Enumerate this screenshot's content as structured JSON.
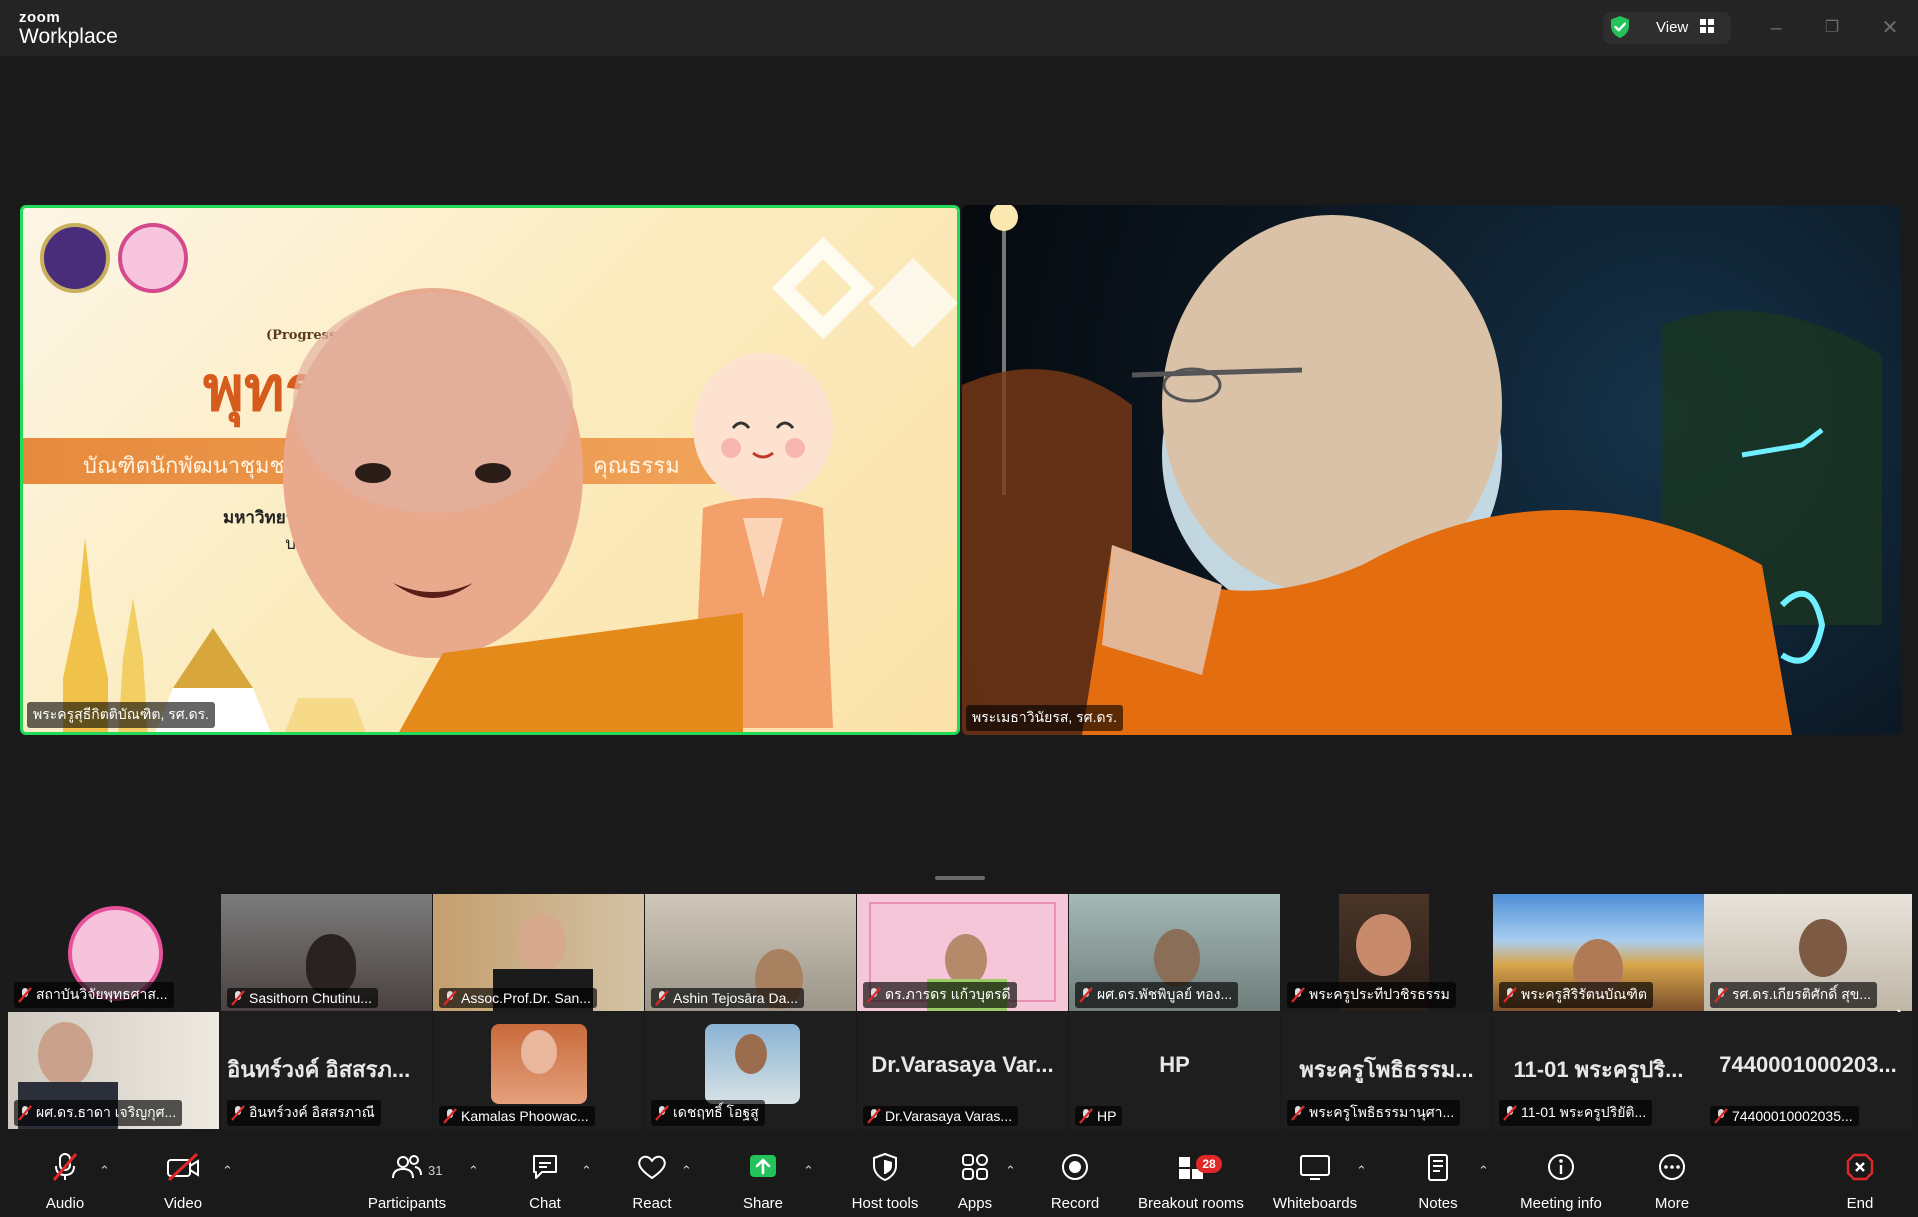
{
  "app": {
    "brand_top": "zoom",
    "brand_bottom": "Workplace",
    "view_label": "View"
  },
  "colors": {
    "active_speaker": "#23d959",
    "end_red": "#e02828",
    "share_green": "#23c25a"
  },
  "main_tiles": [
    {
      "name": "พระครูสุธีกิตติบัณฑิต, รศ.ดร."
    },
    {
      "name": "พระเมธาวินัยรส, รศ.ดร."
    }
  ],
  "slide": {
    "small_title": "(Progress Rep",
    "big_title": "พุทร",
    "banner_left": "บัณฑิตนักพัฒนาชุมชนเชิ",
    "banner_right": "คุณธรรม",
    "sub1": "มหาวิทยาลัย",
    "sub2": "ประ"
  },
  "thumbnails_row1": [
    {
      "label": "สถาบันวิจัยพุทธศาส..."
    },
    {
      "label": "Sasithorn Chutinu..."
    },
    {
      "label": "Assoc.Prof.Dr. San..."
    },
    {
      "label": "Ashin Tejosāra Da..."
    },
    {
      "label": "ดร.ภารดร แก้วบุตรดี"
    },
    {
      "label": "ผศ.ดร.พัชพิบูลย์ ทอง..."
    },
    {
      "label": "พระครูประทีปวชิรธรรม"
    },
    {
      "label": "พระครูสิริรัตนบัณฑิต"
    },
    {
      "label": "รศ.ดร.เกียรติศักดิ์ สุข..."
    }
  ],
  "thumbnails_row2": [
    {
      "label": "ผศ.ดร.ธาดา เจริญกุศ...",
      "display": ""
    },
    {
      "label": "อินทร์วงค์ อิสสรภาณี",
      "display": "อินทร์วงค์ อิสสรภ..."
    },
    {
      "label": "Kamalas Phoowac...",
      "display": ""
    },
    {
      "label": "เดชฤทธิ์ โอฐสู",
      "display": ""
    },
    {
      "label": "Dr.Varasaya Varas...",
      "display": "Dr.Varasaya Var..."
    },
    {
      "label": "HP",
      "display": "HP"
    },
    {
      "label": "พระครูโพธิธรรมานุศา...",
      "display": "พระครูโพธิธรรม..."
    },
    {
      "label": "11-01 พระครูปริยัติ...",
      "display": "11-01 พระครูปริ..."
    },
    {
      "label": "74400010002035...",
      "display": "7440001000203..."
    }
  ],
  "toolbar": {
    "audio": "Audio",
    "video": "Video",
    "participants": "Participants",
    "participants_count": "31",
    "chat": "Chat",
    "react": "React",
    "share": "Share",
    "host_tools": "Host tools",
    "apps": "Apps",
    "record": "Record",
    "breakout_rooms": "Breakout rooms",
    "breakout_badge": "28",
    "whiteboards": "Whiteboards",
    "notes": "Notes",
    "meeting_info": "Meeting info",
    "more": "More",
    "end": "End"
  }
}
